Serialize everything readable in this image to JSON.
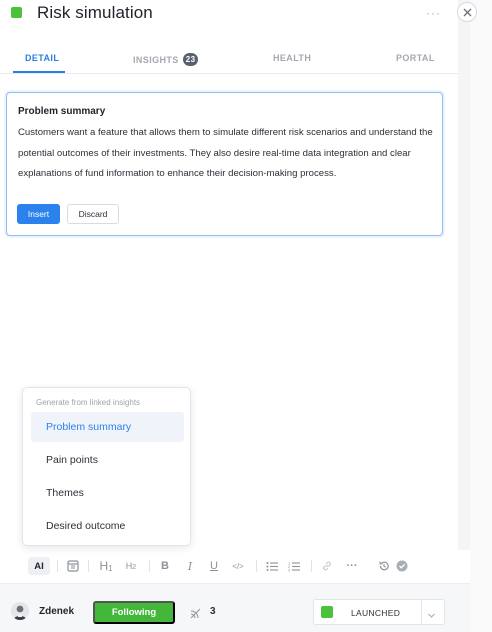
{
  "header": {
    "title": "Risk simulation",
    "more_label": "···",
    "status_color": "#4cc13c",
    "close_icon": "close-icon"
  },
  "tabs": [
    {
      "label": "DETAIL",
      "active": true
    },
    {
      "label": "INSIGHTS",
      "badge": "23",
      "active": false
    },
    {
      "label": "HEALTH",
      "active": false
    },
    {
      "label": "PORTAL",
      "active": false
    }
  ],
  "suggestion": {
    "title": "Problem summary",
    "body": "Customers want a feature that allows them to simulate different risk scenarios and understand the potential outcomes of their investments. They also desire real-time data integration and clear explanations of fund information to enhance their decision-making process.",
    "insert_label": "Insert",
    "discard_label": "Discard"
  },
  "ai_menu": {
    "heading": "Generate from linked insights",
    "items": [
      {
        "label": "Problem summary",
        "selected": true
      },
      {
        "label": "Pain points",
        "selected": false
      },
      {
        "label": "Themes",
        "selected": false
      },
      {
        "label": "Desired outcome",
        "selected": false
      }
    ]
  },
  "toolbar": {
    "ai_label": "AI",
    "h1_label": "H",
    "h1_sub": "1",
    "h2_label": "H",
    "h2_sub": "2",
    "bold_label": "B",
    "italic_label": "I",
    "underline_label": "U",
    "code_label": "</>",
    "more_label": "···"
  },
  "footer": {
    "user_name": "Zdenek",
    "following_label": "Following",
    "signal_count": "3",
    "status_label": "LAUNCHED",
    "status_color": "#4cc13c"
  },
  "colors": {
    "accent": "#2b82ec",
    "success": "#42b73a",
    "tab_active": "#2b7fe0"
  }
}
